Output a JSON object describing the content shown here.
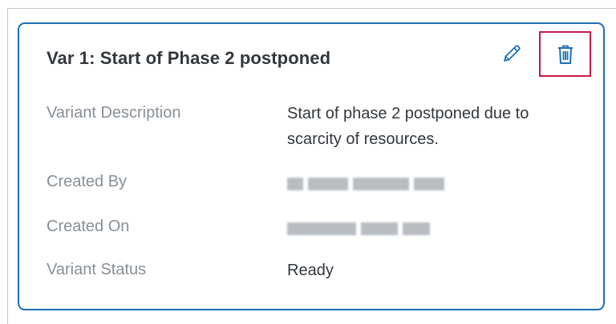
{
  "card": {
    "title": "Var 1: Start of Phase 2 postponed",
    "fields": [
      {
        "label": "Variant Description",
        "value": "Start of phase 2 postponed due to scarcity of resources."
      },
      {
        "label": "Created By",
        "value": ""
      },
      {
        "label": "Created On",
        "value": ""
      },
      {
        "label": "Variant Status",
        "value": "Ready"
      }
    ]
  },
  "icons": {
    "edit": "pencil-icon",
    "delete": "trash-icon"
  },
  "colors": {
    "card_border": "#1d6fb8",
    "icon": "#1d6fb8",
    "highlight_border": "#c8194b",
    "label_text": "#8a8f96",
    "value_text": "#33373d"
  }
}
